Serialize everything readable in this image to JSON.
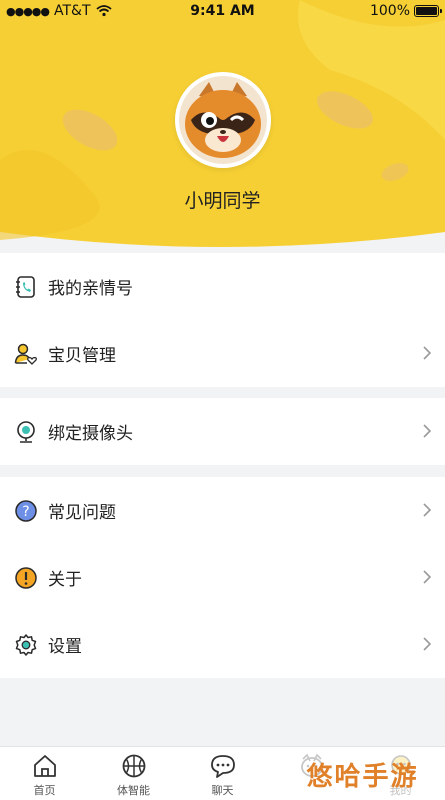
{
  "status_bar": {
    "carrier": "AT&T",
    "time": "9:41 AM",
    "battery": "100%"
  },
  "profile": {
    "name": "小明同学"
  },
  "menu": {
    "family_numbers": "我的亲情号",
    "baby_management": "宝贝管理",
    "bind_camera": "绑定摄像头",
    "faq": "常见问题",
    "about": "关于",
    "settings": "设置"
  },
  "tabs": [
    {
      "label": "首页",
      "icon": "home-icon"
    },
    {
      "label": "体智能",
      "icon": "basketball-icon"
    },
    {
      "label": "聊天",
      "icon": "chat-icon"
    },
    {
      "label": "",
      "icon": "fox-icon"
    },
    {
      "label": "我的",
      "icon": "profile-icon"
    }
  ],
  "watermark": "悠哈手游",
  "colors": {
    "brand_yellow": "#f6cf34",
    "background": "#f2f3f5"
  }
}
